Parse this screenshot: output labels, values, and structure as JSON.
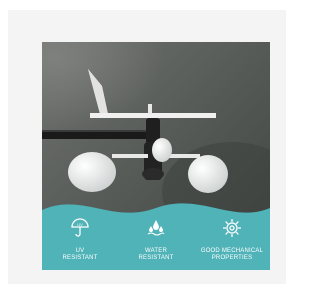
{
  "features": [
    {
      "icon": "umbrella-icon",
      "label_line1": "UV",
      "label_line2": "RESISTANT"
    },
    {
      "icon": "water-drops-icon",
      "label_line1": "WATER",
      "label_line2": "RESISTANT"
    },
    {
      "icon": "gear-icon",
      "label_line1": "GOOD MECHANICAL",
      "label_line2": "PROPERTIES"
    }
  ],
  "colors": {
    "accent": "#4fb3b8",
    "background": "#f4f4f4"
  },
  "photo": {
    "subject": "anemometer-with-wind-vane"
  }
}
